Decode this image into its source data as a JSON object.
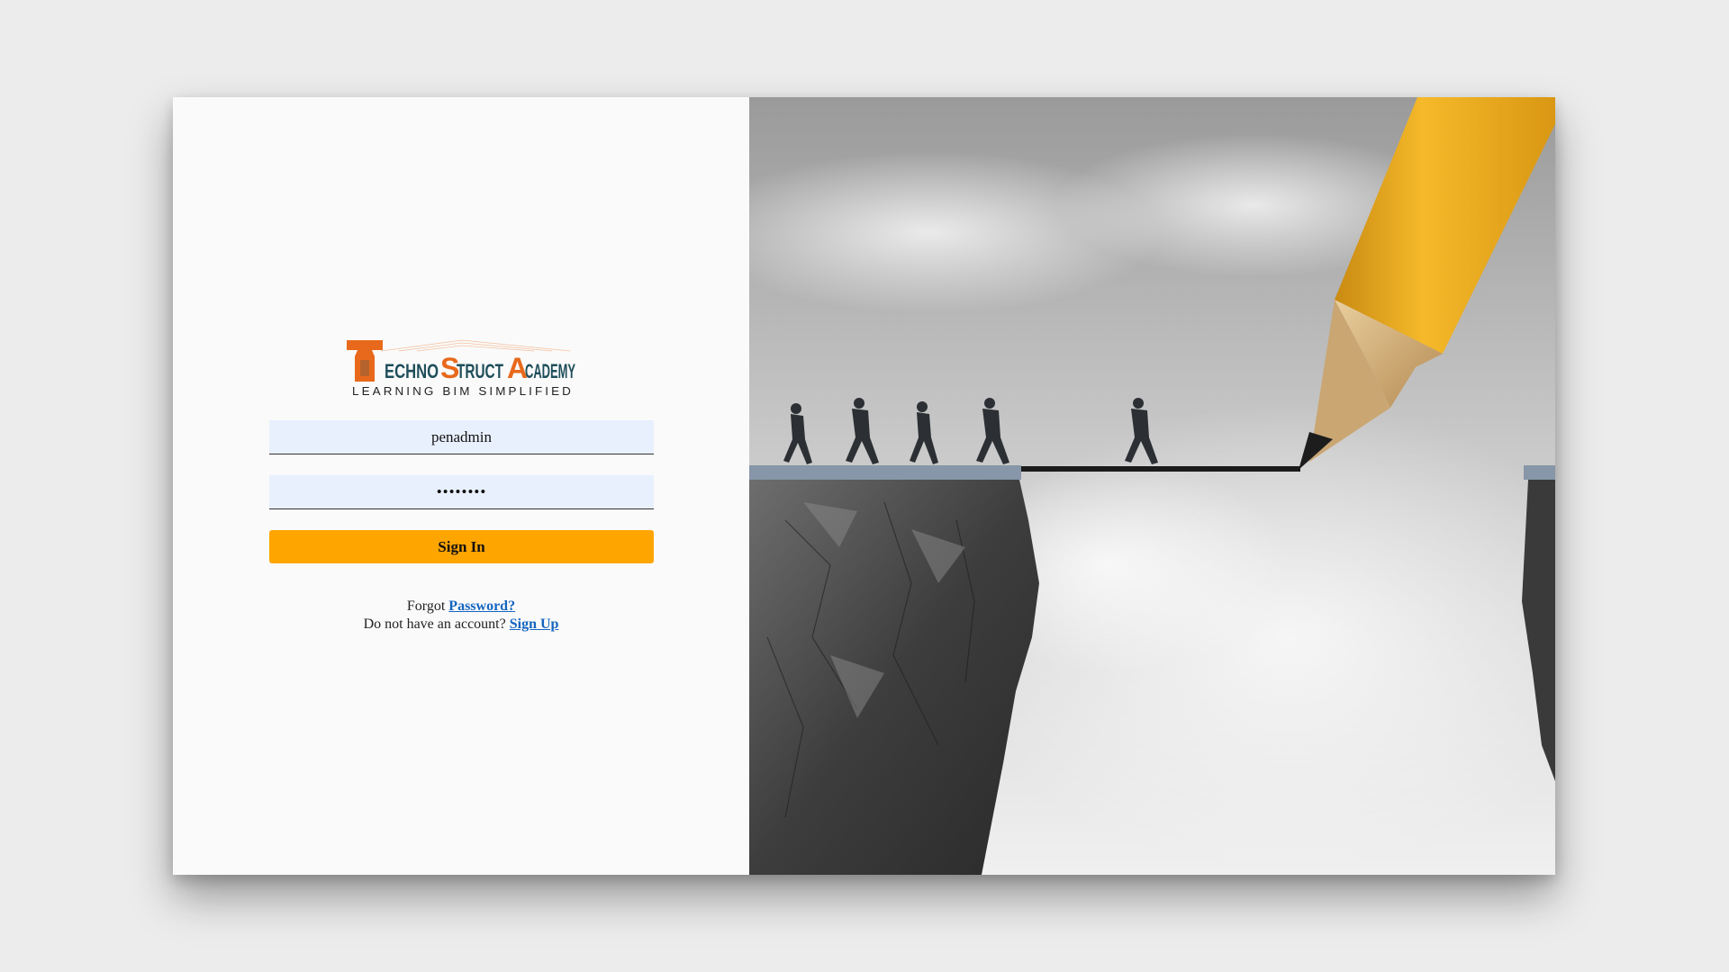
{
  "logo": {
    "name_part1": "TECHNOSTRUCT ACADEMY",
    "tagline": "LEARNING BIM SIMPLIFIED"
  },
  "form": {
    "username_value": "penadmin",
    "password_value": "penadmin",
    "signin_label": "Sign In"
  },
  "links": {
    "forgot_prefix": "Forgot",
    "forgot_link": "Password?",
    "signup_prefix": "Do not have an account?",
    "signup_link": "Sign Up"
  },
  "colors": {
    "accent": "#ffa500",
    "logo_orange": "#e8691c",
    "logo_teal": "#1f4e5a",
    "link": "#1565c0"
  }
}
